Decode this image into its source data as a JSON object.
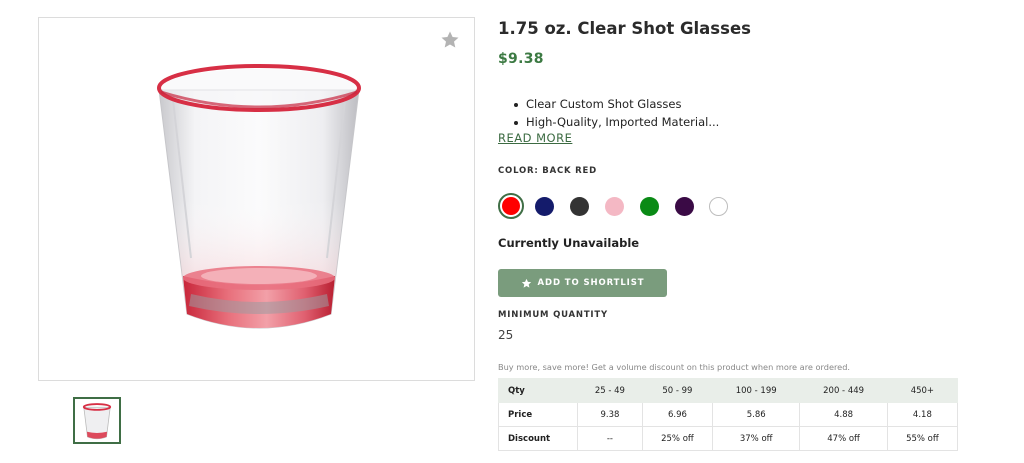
{
  "product": {
    "title": "1.75 oz. Clear Shot Glasses",
    "price": "$9.38",
    "bullets": [
      "Clear Custom Shot Glasses",
      "High-Quality, Imported Material..."
    ],
    "read_more_label": "READ MORE"
  },
  "color": {
    "label": "COLOR: BACK RED",
    "swatches": [
      {
        "name": "red",
        "hex": "#ff0000",
        "selected": true
      },
      {
        "name": "navy",
        "hex": "#141b6b"
      },
      {
        "name": "charcoal",
        "hex": "#333333"
      },
      {
        "name": "pink",
        "hex": "#f4b8c4"
      },
      {
        "name": "green",
        "hex": "#0a8a15"
      },
      {
        "name": "purple",
        "hex": "#3a0a45"
      },
      {
        "name": "white",
        "hex": "#ffffff"
      }
    ]
  },
  "availability": "Currently Unavailable",
  "shortlist_button_label": "ADD TO SHORTLIST",
  "minimum_quantity": {
    "label": "MINIMUM QUANTITY",
    "value": "25"
  },
  "volume_note": "Buy more, save more! Get a volume discount on this product when more are ordered.",
  "pricing_table": {
    "rows": [
      [
        "Qty",
        "25 - 49",
        "50 - 99",
        "100 - 199",
        "200 - 449",
        "450+"
      ],
      [
        "Price",
        "9.38",
        "6.96",
        "5.86",
        "4.88",
        "4.18"
      ],
      [
        "Discount",
        "--",
        "25% off",
        "37% off",
        "47% off",
        "55% off"
      ]
    ]
  },
  "colors": {
    "accent_green": "#3c7a43",
    "button_green": "#7a9c7d",
    "glass_red": "#d9303f"
  }
}
